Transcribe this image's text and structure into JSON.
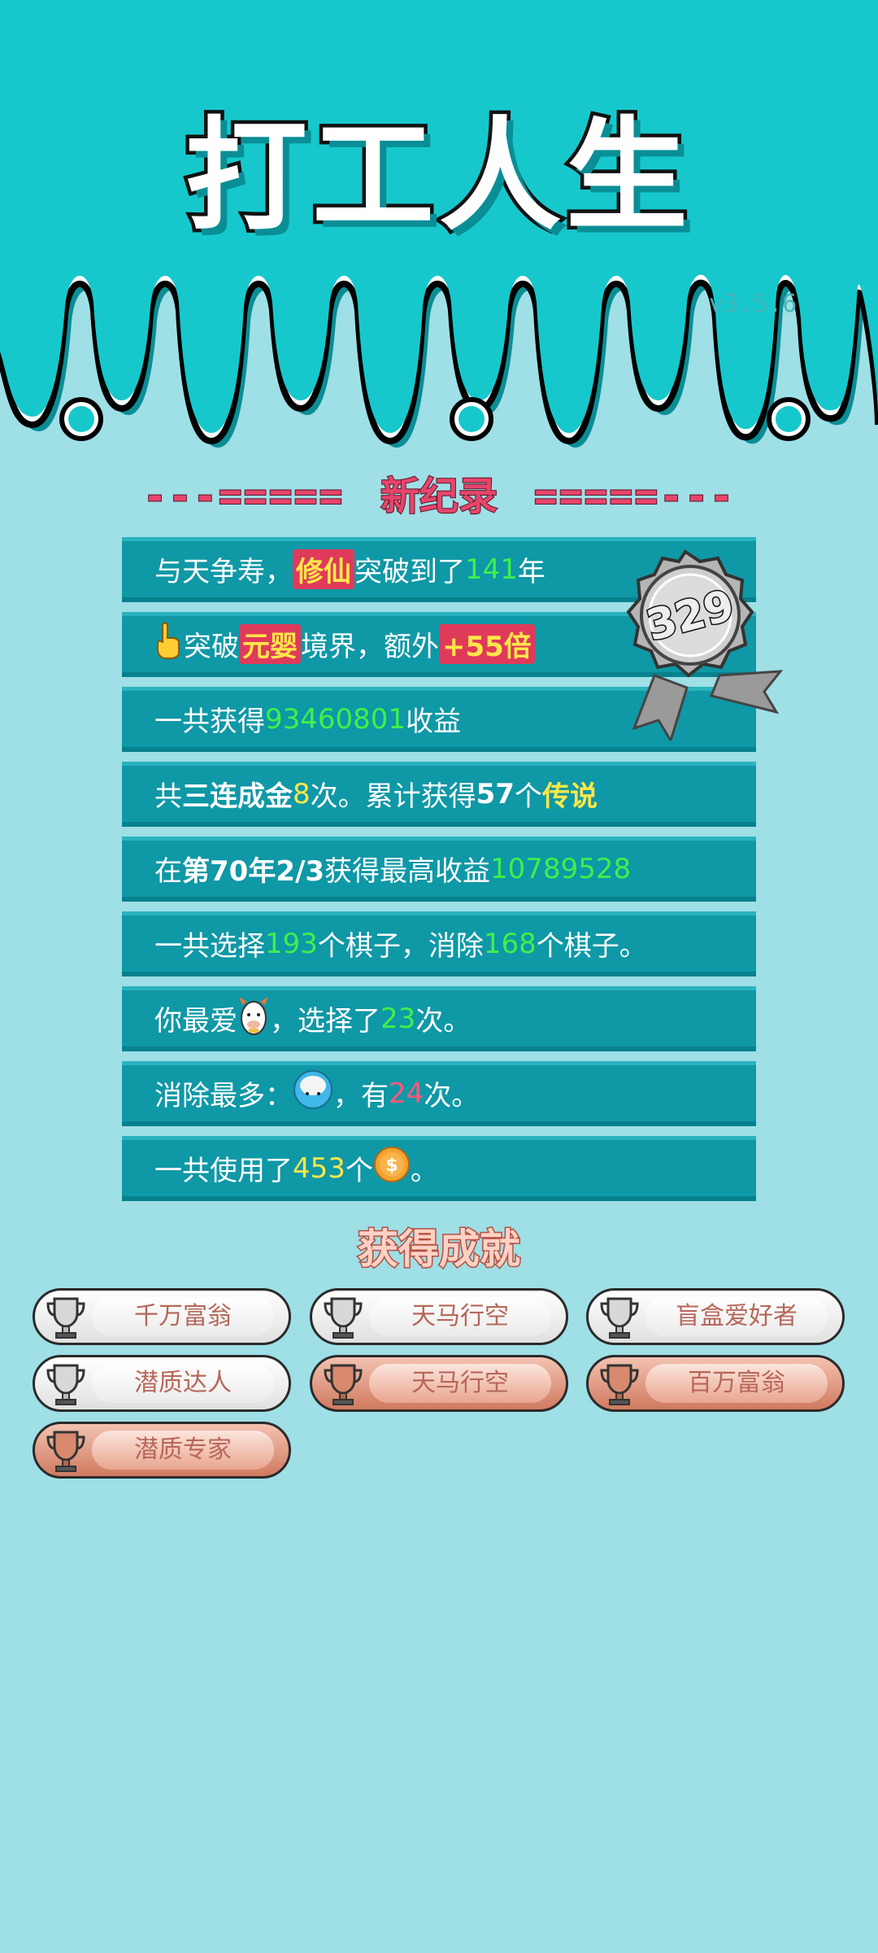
{
  "header": {
    "title": "打工人生",
    "version": "v3.5.6"
  },
  "record": {
    "left_deco": "---=====",
    "title": "新纪录",
    "right_deco": "=====---",
    "badge_number": "329"
  },
  "stats": [
    {
      "p1": "与天争寿，",
      "hl": "修仙",
      "p2": "突破到了",
      "num": "141",
      "p3": "年"
    },
    {
      "icon": "pointing-hand-icon",
      "p1": "突破",
      "hl": "元婴",
      "p2": "境界，额外",
      "plus": "+55倍"
    },
    {
      "p1": "一共获得",
      "num": "93460801",
      "p2": "收益"
    },
    {
      "p1": "共",
      "b1": "三连成金",
      "num": "8",
      "p2": "次。累计获得",
      "b2": "57",
      "p3": "个",
      "y1": "传说"
    },
    {
      "p1": "在 ",
      "b1": "第70年2/3",
      "p2": " 获得最高收益",
      "num": "10789528"
    },
    {
      "p1": "一共选择",
      "num1": "193",
      "p2": "个棋子，消除",
      "num2": "168",
      "p3": "个棋子。"
    },
    {
      "p1": "你最爱",
      "icon": "cow-icon",
      "p2": "，选择了",
      "num": "23",
      "p3": "次。"
    },
    {
      "p1": "消除最多：",
      "icon": "rice-bowl-icon",
      "p2": "，有",
      "num": "24",
      "p3": "次。"
    },
    {
      "p1": "一共使用了",
      "num": "453",
      "p2": "个",
      "icon": "coin-icon",
      "p3": "。"
    }
  ],
  "achievements": {
    "title": "获得成就",
    "items": [
      {
        "label": "千万富翁",
        "tier": "silver"
      },
      {
        "label": "天马行空",
        "tier": "silver"
      },
      {
        "label": "盲盒爱好者",
        "tier": "silver"
      },
      {
        "label": "潜质达人",
        "tier": "silver"
      },
      {
        "label": "天马行空",
        "tier": "bronze"
      },
      {
        "label": "百万富翁",
        "tier": "bronze"
      },
      {
        "label": "潜质专家",
        "tier": "bronze"
      }
    ]
  },
  "colors": {
    "teal": "#16c8cc",
    "background": "#9fdfe6",
    "row": "#0f98a6",
    "highlight_red": "#e03a5b",
    "number_green": "#3ef04a",
    "number_yellow": "#ffe74a"
  }
}
